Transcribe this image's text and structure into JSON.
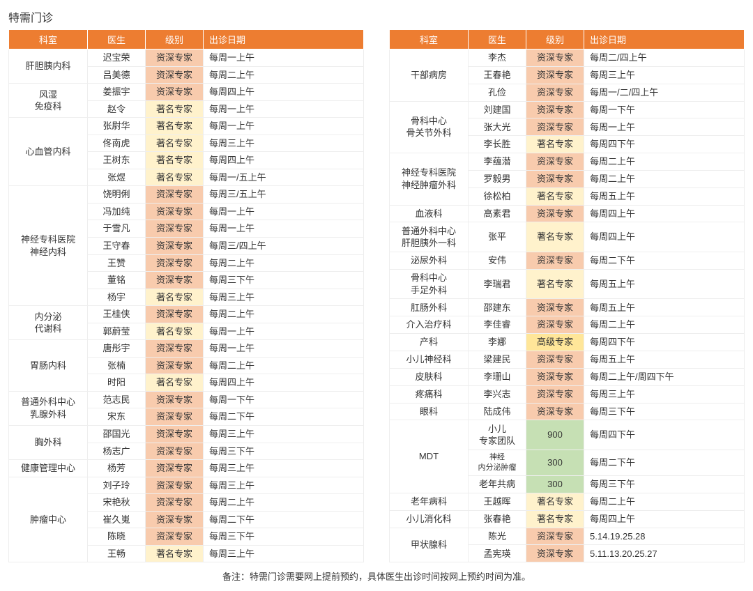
{
  "title": "特需门诊",
  "headers": [
    "科室",
    "医生",
    "级别",
    "出诊日期"
  ],
  "note": "备注：特需门诊需要网上提前预约，具体医生出诊时间按网上预约时间为准。",
  "left": [
    {
      "dept": "肝胆胰内科",
      "rows": [
        {
          "doctor": "迟宝荣",
          "level": "资深专家",
          "date": "每周一上午"
        },
        {
          "doctor": "吕美德",
          "level": "资深专家",
          "date": "每周二上午"
        }
      ]
    },
    {
      "dept": "风湿\n免疫科",
      "rows": [
        {
          "doctor": "姜振宇",
          "level": "资深专家",
          "date": "每周四上午"
        },
        {
          "doctor": "赵令",
          "level": "著名专家",
          "date": "每周一上午"
        }
      ]
    },
    {
      "dept": "心血管内科",
      "rows": [
        {
          "doctor": "张尉华",
          "level": "著名专家",
          "date": "每周一上午"
        },
        {
          "doctor": "佟南虎",
          "level": "著名专家",
          "date": "每周三上午"
        },
        {
          "doctor": "王树东",
          "level": "著名专家",
          "date": "每周四上午"
        },
        {
          "doctor": "张煜",
          "level": "著名专家",
          "date": "每周一/五上午"
        }
      ]
    },
    {
      "dept": "神经专科医院\n神经内科",
      "rows": [
        {
          "doctor": "饶明俐",
          "level": "资深专家",
          "date": "每周三/五上午"
        },
        {
          "doctor": "冯加纯",
          "level": "资深专家",
          "date": "每周一上午"
        },
        {
          "doctor": "于雪凡",
          "level": "资深专家",
          "date": "每周一上午"
        },
        {
          "doctor": "王守春",
          "level": "资深专家",
          "date": "每周三/四上午"
        },
        {
          "doctor": "王赞",
          "level": "资深专家",
          "date": "每周二上午"
        },
        {
          "doctor": "董铭",
          "level": "资深专家",
          "date": "每周三下午"
        },
        {
          "doctor": "杨宇",
          "level": "著名专家",
          "date": "每周三上午"
        }
      ]
    },
    {
      "dept": "内分泌\n代谢科",
      "rows": [
        {
          "doctor": "王桂侠",
          "level": "资深专家",
          "date": "每周二上午"
        },
        {
          "doctor": "郭蔚莹",
          "level": "著名专家",
          "date": "每周一上午"
        }
      ]
    },
    {
      "dept": "胃肠内科",
      "rows": [
        {
          "doctor": "唐彤宇",
          "level": "资深专家",
          "date": "每周一上午"
        },
        {
          "doctor": "张楠",
          "level": "资深专家",
          "date": "每周二上午"
        },
        {
          "doctor": "时阳",
          "level": "著名专家",
          "date": "每周四上午"
        }
      ]
    },
    {
      "dept": "普通外科中心\n乳腺外科",
      "rows": [
        {
          "doctor": "范志民",
          "level": "资深专家",
          "date": "每周一下午"
        },
        {
          "doctor": "宋东",
          "level": "资深专家",
          "date": "每周二下午"
        }
      ]
    },
    {
      "dept": "胸外科",
      "rows": [
        {
          "doctor": "邵国光",
          "level": "资深专家",
          "date": "每周三上午"
        },
        {
          "doctor": "杨志广",
          "level": "资深专家",
          "date": "每周三下午"
        }
      ]
    },
    {
      "dept": "健康管理中心",
      "rows": [
        {
          "doctor": "杨芳",
          "level": "资深专家",
          "date": "每周三上午"
        }
      ]
    },
    {
      "dept": "肿瘤中心",
      "rows": [
        {
          "doctor": "刘子玲",
          "level": "资深专家",
          "date": "每周三上午"
        },
        {
          "doctor": "宋艳秋",
          "level": "资深专家",
          "date": "每周二上午"
        },
        {
          "doctor": "崔久嵬",
          "level": "资深专家",
          "date": "每周二下午"
        },
        {
          "doctor": "陈晓",
          "level": "资深专家",
          "date": "每周三下午"
        },
        {
          "doctor": "王畅",
          "level": "著名专家",
          "date": "每周三上午"
        }
      ]
    }
  ],
  "right": [
    {
      "dept": "干部病房",
      "rows": [
        {
          "doctor": "李杰",
          "level": "资深专家",
          "date": "每周二/四上午"
        },
        {
          "doctor": "王春艳",
          "level": "资深专家",
          "date": "每周三上午"
        },
        {
          "doctor": "孔俭",
          "level": "资深专家",
          "date": "每周一/二/四上午"
        }
      ]
    },
    {
      "dept": "骨科中心\n骨关节外科",
      "rows": [
        {
          "doctor": "刘建国",
          "level": "资深专家",
          "date": "每周一下午"
        },
        {
          "doctor": "张大光",
          "level": "资深专家",
          "date": "每周一上午"
        },
        {
          "doctor": "李长胜",
          "level": "著名专家",
          "date": "每周四下午"
        }
      ]
    },
    {
      "dept": "神经专科医院\n神经肿瘤外科",
      "rows": [
        {
          "doctor": "李蕴潜",
          "level": "资深专家",
          "date": "每周二上午"
        },
        {
          "doctor": "罗毅男",
          "level": "资深专家",
          "date": "每周二上午"
        },
        {
          "doctor": "徐松柏",
          "level": "著名专家",
          "date": "每周五上午"
        }
      ]
    },
    {
      "dept": "血液科",
      "rows": [
        {
          "doctor": "高素君",
          "level": "资深专家",
          "date": "每周四上午"
        }
      ]
    },
    {
      "dept": "普通外科中心\n肝胆胰外一科",
      "rows": [
        {
          "doctor": "张平",
          "level": "著名专家",
          "date": "每周四上午"
        }
      ]
    },
    {
      "dept": "泌尿外科",
      "rows": [
        {
          "doctor": "安伟",
          "level": "资深专家",
          "date": "每周二下午"
        }
      ]
    },
    {
      "dept": "骨科中心\n手足外科",
      "rows": [
        {
          "doctor": "李瑞君",
          "level": "著名专家",
          "date": "每周五上午"
        }
      ]
    },
    {
      "dept": "肛肠外科",
      "rows": [
        {
          "doctor": "邵建东",
          "level": "资深专家",
          "date": "每周五上午"
        }
      ]
    },
    {
      "dept": "介入治疗科",
      "rows": [
        {
          "doctor": "李佳睿",
          "level": "资深专家",
          "date": "每周二上午"
        }
      ]
    },
    {
      "dept": "产科",
      "rows": [
        {
          "doctor": "李娜",
          "level": "高级专家",
          "date": "每周四下午"
        }
      ]
    },
    {
      "dept": "小儿神经科",
      "rows": [
        {
          "doctor": "梁建民",
          "level": "资深专家",
          "date": "每周五上午"
        }
      ]
    },
    {
      "dept": "皮肤科",
      "rows": [
        {
          "doctor": "李珊山",
          "level": "资深专家",
          "date": "每周二上午/周四下午"
        }
      ]
    },
    {
      "dept": "疼痛科",
      "rows": [
        {
          "doctor": "李兴志",
          "level": "资深专家",
          "date": "每周三上午"
        }
      ]
    },
    {
      "dept": "眼科",
      "rows": [
        {
          "doctor": "陆成伟",
          "level": "资深专家",
          "date": "每周三下午"
        }
      ]
    },
    {
      "dept": "MDT",
      "rows": [
        {
          "doctor": "小儿\n专家团队",
          "level": "900",
          "date": "每周四下午",
          "levelType": "num"
        },
        {
          "doctor": "神经\n内分泌肿瘤",
          "level": "300",
          "date": "每周二下午",
          "levelType": "num",
          "smallDoctor": true
        },
        {
          "doctor": "老年共病",
          "level": "300",
          "date": "每周三下午",
          "levelType": "num"
        }
      ]
    },
    {
      "dept": "老年病科",
      "rows": [
        {
          "doctor": "王越晖",
          "level": "著名专家",
          "date": "每周二上午"
        }
      ]
    },
    {
      "dept": "小儿消化科",
      "rows": [
        {
          "doctor": "张春艳",
          "level": "著名专家",
          "date": "每周四上午"
        }
      ]
    },
    {
      "dept": "甲状腺科",
      "rows": [
        {
          "doctor": "陈光",
          "level": "资深专家",
          "date": "5.14.19.25.28"
        },
        {
          "doctor": "孟宪瑛",
          "level": "资深专家",
          "date": "5.11.13.20.25.27"
        }
      ]
    }
  ]
}
